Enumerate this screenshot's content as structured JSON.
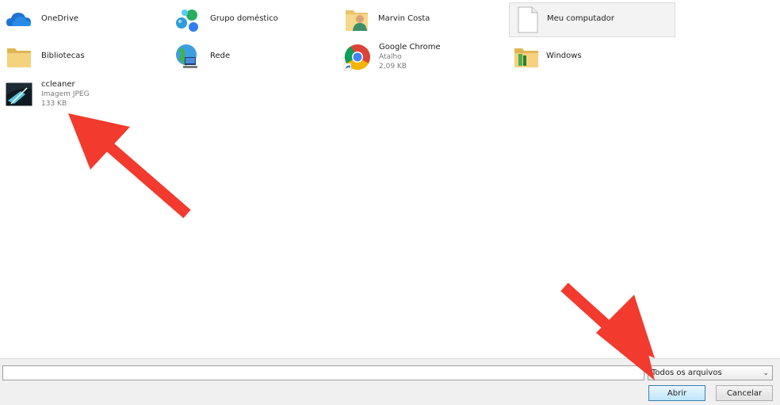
{
  "files": [
    {
      "name": "OneDrive",
      "sub1": "",
      "sub2": "",
      "icon": "onedrive-icon"
    },
    {
      "name": "Grupo doméstico",
      "sub1": "",
      "sub2": "",
      "icon": "homegroup-icon"
    },
    {
      "name": "Marvin Costa",
      "sub1": "",
      "sub2": "",
      "icon": "user-folder-icon"
    },
    {
      "name": "Meu computador",
      "sub1": "",
      "sub2": "",
      "icon": "blank-file-icon"
    },
    {
      "name": "Bibliotecas",
      "sub1": "",
      "sub2": "",
      "icon": "folder-icon"
    },
    {
      "name": "Rede",
      "sub1": "",
      "sub2": "",
      "icon": "network-icon"
    },
    {
      "name": "Google Chrome",
      "sub1": "Atalho",
      "sub2": "2,09 KB",
      "icon": "chrome-icon"
    },
    {
      "name": "Windows",
      "sub1": "",
      "sub2": "",
      "icon": "windows-folder-icon"
    },
    {
      "name": "ccleaner",
      "sub1": "Imagem JPEG",
      "sub2": "133 KB",
      "icon": "jpeg-thumbnail-icon"
    }
  ],
  "footer": {
    "filename_value": "",
    "filetype_selected": "Todos os arquivos",
    "open_label": "Abrir",
    "cancel_label": "Cancelar"
  },
  "colors": {
    "arrow": "#f23a2e",
    "selected_bg": "#f3f3f3",
    "primary_button_border": "#3c7fb1"
  }
}
